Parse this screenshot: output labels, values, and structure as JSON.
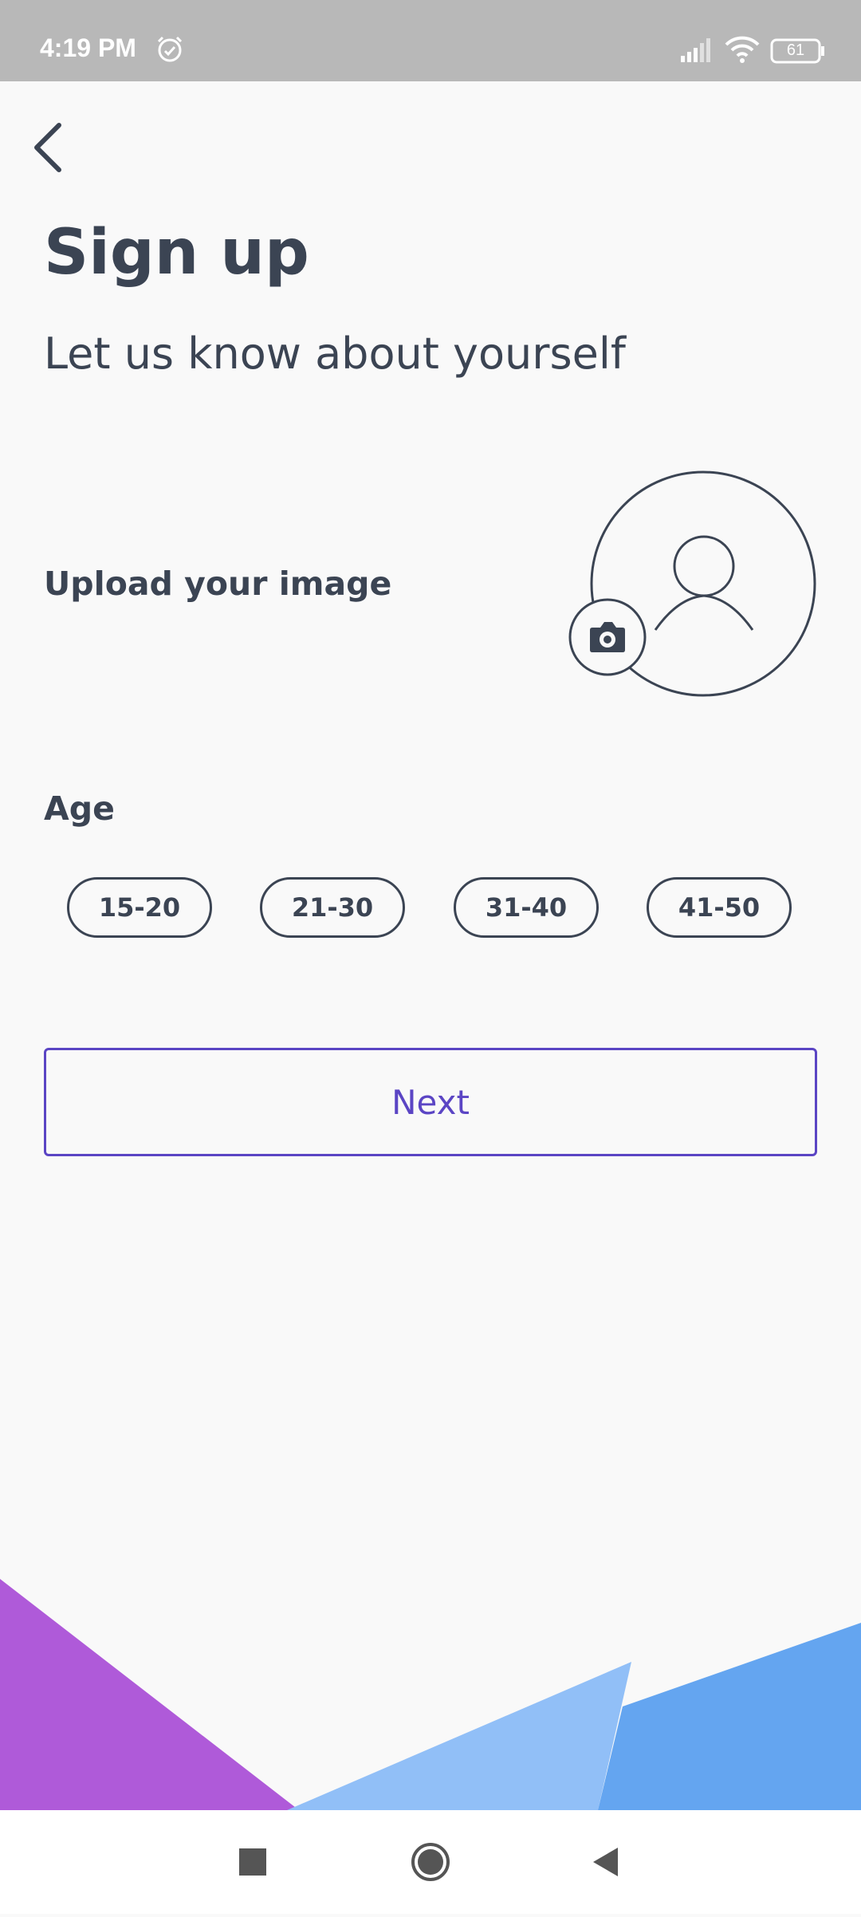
{
  "status_bar": {
    "time": "4:19 PM",
    "battery": "61",
    "icons": [
      "alarm-icon",
      "signal-icon",
      "wifi-icon",
      "battery-icon"
    ]
  },
  "header": {
    "back_icon": "chevron-left-icon",
    "title": "Sign up",
    "subtitle": "Let us know about yourself"
  },
  "upload": {
    "label": "Upload your image",
    "avatar_icon": "user-avatar-icon",
    "camera_icon": "camera-icon"
  },
  "age": {
    "label": "Age",
    "options": [
      "15-20",
      "21-30",
      "31-40",
      "41-50"
    ]
  },
  "next_button": {
    "label": "Next"
  },
  "colors": {
    "text": "#3b4453",
    "accent": "#5b45c4",
    "background": "#f9f9f9",
    "decor_purple": "#af5ad9",
    "decor_light_blue": "#91bff7",
    "decor_blue": "#64a5f0"
  },
  "nav_bar": {
    "icons": [
      "recents-square-icon",
      "home-circle-icon",
      "back-triangle-icon"
    ]
  }
}
